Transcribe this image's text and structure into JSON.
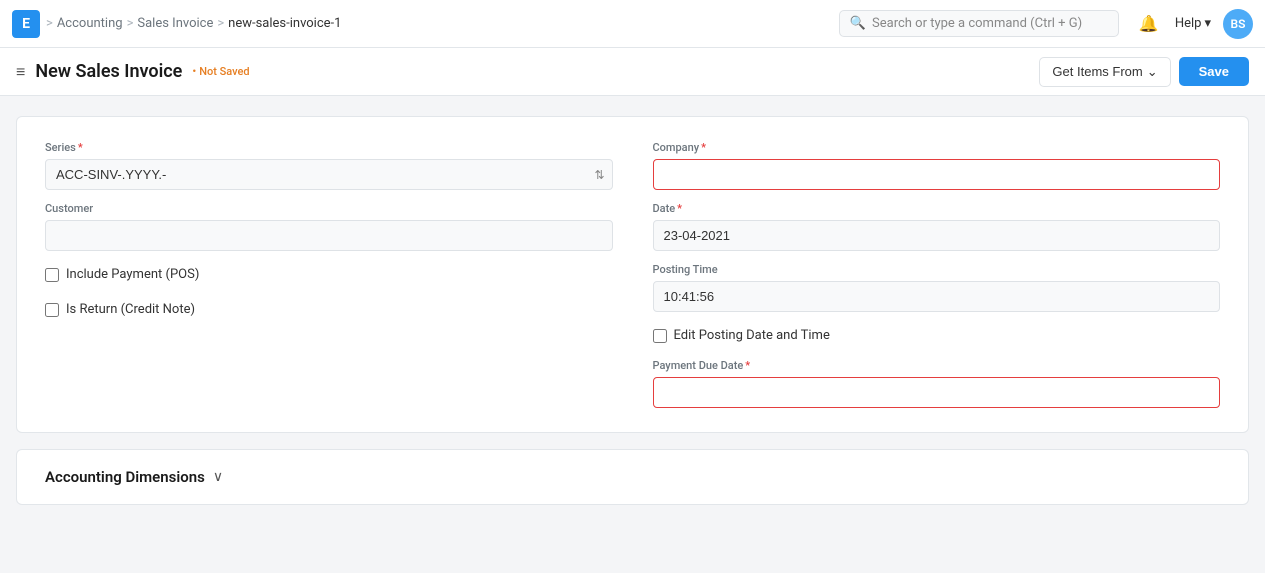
{
  "topbar": {
    "logo_text": "E",
    "breadcrumbs": [
      {
        "label": "Accounting"
      },
      {
        "label": "Sales Invoice"
      },
      {
        "label": "new-sales-invoice-1"
      }
    ],
    "search_placeholder": "Search or type a command (Ctrl + G)",
    "help_label": "Help",
    "avatar_initials": "BS"
  },
  "page_header": {
    "menu_icon": "≡",
    "title": "New Sales Invoice",
    "status_dot": "•",
    "status_text": "Not Saved",
    "get_items_label": "Get Items From",
    "save_label": "Save"
  },
  "form": {
    "series_label": "Series",
    "series_value": "ACC-SINV-.YYYY.-",
    "company_label": "Company",
    "company_value": "",
    "customer_label": "Customer",
    "customer_value": "",
    "include_payment_label": "Include Payment (POS)",
    "is_return_label": "Is Return (Credit Note)",
    "date_label": "Date",
    "date_value": "23-04-2021",
    "posting_time_label": "Posting Time",
    "posting_time_value": "10:41:56",
    "edit_posting_label": "Edit Posting Date and Time",
    "payment_due_label": "Payment Due Date",
    "payment_due_value": ""
  },
  "accounting_dimensions": {
    "title": "Accounting Dimensions",
    "chevron": "∨"
  },
  "icons": {
    "search": "🔍",
    "bell": "🔔",
    "chevron_down": "⌄",
    "hamburger": "≡",
    "breadcrumb_sep": ">"
  }
}
